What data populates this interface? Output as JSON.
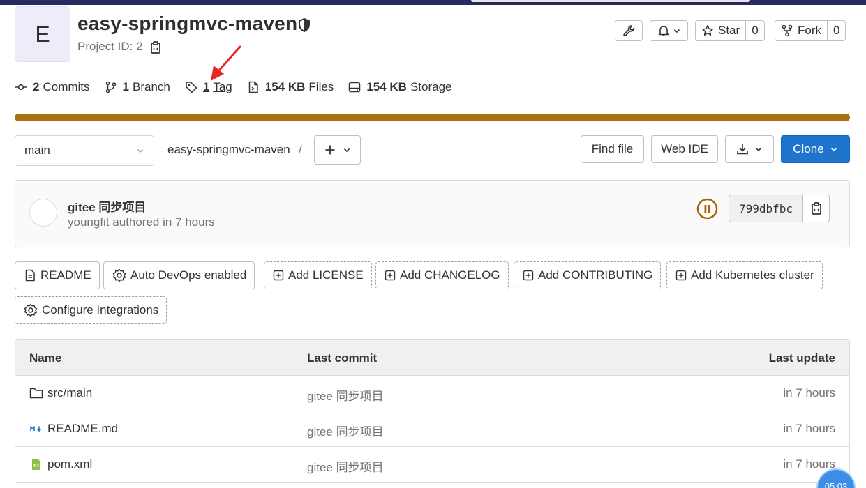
{
  "project": {
    "avatar_letter": "E",
    "title": "easy-springmvc-maven",
    "id_label": "Project ID: 2"
  },
  "header_buttons": {
    "star_label": "Star",
    "star_count": "0",
    "fork_label": "Fork",
    "fork_count": "0"
  },
  "stats": {
    "commits_count": "2",
    "commits_label": "Commits",
    "branch_count": "1",
    "branch_label": "Branch",
    "tag_count": "1",
    "tag_label": "Tag",
    "files_size": "154 KB",
    "files_label": "Files",
    "storage_size": "154 KB",
    "storage_label": "Storage"
  },
  "language_bar": {
    "color": "#a8730e"
  },
  "repo_nav": {
    "branch": "main",
    "breadcrumb": "easy-springmvc-maven",
    "separator": "/",
    "find_file": "Find file",
    "web_ide": "Web IDE",
    "clone": "Clone"
  },
  "last_commit": {
    "message": "gitee 同步项目",
    "meta": "youngfit authored in 7 hours",
    "sha": "799dbfbc",
    "pipeline_status_color": "#ab6100"
  },
  "quick_actions": {
    "readme": "README",
    "auto_devops": "Auto DevOps enabled",
    "add_license": "Add LICENSE",
    "add_changelog": "Add CHANGELOG",
    "add_contributing": "Add CONTRIBUTING",
    "add_k8s": "Add Kubernetes cluster",
    "configure_integrations": "Configure Integrations"
  },
  "file_table": {
    "headers": {
      "name": "Name",
      "last_commit": "Last commit",
      "last_update": "Last update"
    },
    "rows": [
      {
        "name": "src/main",
        "icon": "folder-icon",
        "commit": "gitee 同步项目",
        "updated": "in 7 hours"
      },
      {
        "name": "README.md",
        "icon": "markdown-icon",
        "commit": "gitee 同步项目",
        "updated": "in 7 hours"
      },
      {
        "name": "pom.xml",
        "icon": "xml-file-icon",
        "commit": "gitee 同步项目",
        "updated": "in 7 hours"
      }
    ]
  },
  "overlay": {
    "timer": "05:03"
  }
}
